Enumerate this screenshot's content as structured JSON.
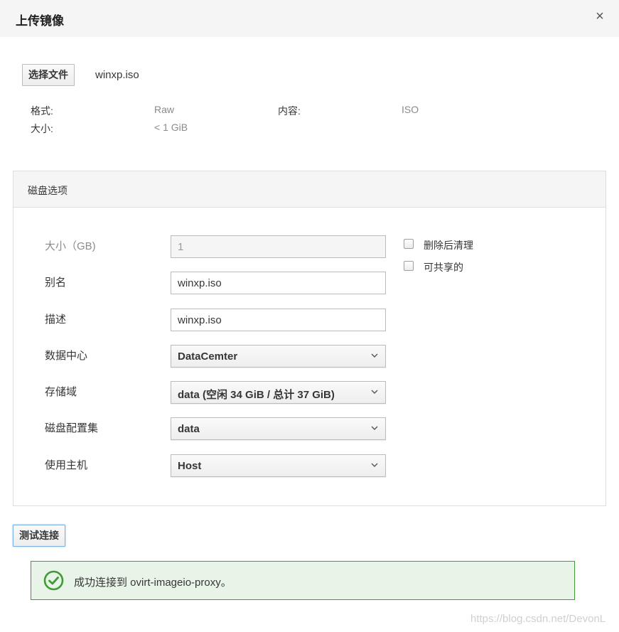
{
  "dialog": {
    "title": "上传镜像",
    "close_label": "×"
  },
  "file": {
    "choose_button": "选择文件",
    "file_name": "winxp.iso",
    "format_label": "格式:",
    "format_value": "Raw",
    "content_label": "内容:",
    "content_value": "ISO",
    "size_label": "大小:",
    "size_value": "< 1 GiB"
  },
  "disk_options": {
    "title": "磁盘选项",
    "size": {
      "label": "大小（GB)",
      "value": "1"
    },
    "alias": {
      "label": "别名",
      "value": "winxp.iso"
    },
    "description": {
      "label": "描述",
      "value": "winxp.iso"
    },
    "data_center": {
      "label": "数据中心",
      "value": "DataCemter"
    },
    "storage_domain": {
      "label": "存储域",
      "value": "data (空闲 34 GiB / 总计 37 GiB)"
    },
    "disk_profile": {
      "label": "磁盘配置集",
      "value": "data"
    },
    "host": {
      "label": "使用主机",
      "value": "Host"
    },
    "wipe_after_delete": {
      "label": "删除后清理",
      "checked": false
    },
    "shareable": {
      "label": "可共享的",
      "checked": false
    }
  },
  "test_connection_button": "测试连接",
  "alert": {
    "message": "成功连接到 ovirt-imageio-proxy。",
    "icon": "check-circle-icon",
    "border_color": "#3f9c35",
    "background_color": "#e9f4e9"
  },
  "watermark": "https://blog.csdn.net/DevonL"
}
